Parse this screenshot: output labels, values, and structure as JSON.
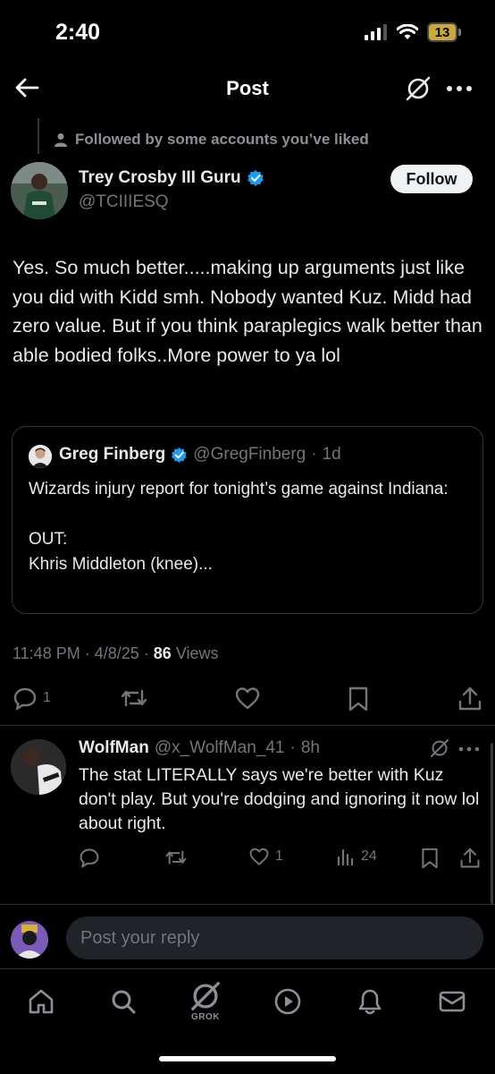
{
  "status_bar": {
    "time": "2:40",
    "battery": "13"
  },
  "header": {
    "title": "Post"
  },
  "social_context": "Followed by some accounts you’ve liked",
  "post": {
    "author_name": "Trey Crosby III Guru",
    "author_handle": "@TCIIIESQ",
    "follow_label": "Follow",
    "text": "Yes. So much better.....making up arguments just like you did with Kidd smh. Nobody wanted Kuz. Midd had zero value. But if you think paraplegics walk better than able bodied folks..More power to ya lol",
    "time": "11:48 PM",
    "date": "4/8/25",
    "views_count": "86",
    "views_label": "Views",
    "reply_count": "1"
  },
  "quote": {
    "author_name": "Greg Finberg",
    "author_handle": "@GregFinberg",
    "age": "1d",
    "text": "Wizards injury report for tonight’s game against Indiana:\n\nOUT:\nKhris Middleton (knee)..."
  },
  "reply": {
    "author_name": "WolfMan",
    "author_handle": "@x_WolfMan_41",
    "age": "8h",
    "text": "The stat LITERALLY says we're better with Kuz don't play. But you're dodging and ignoring it now lol about right.",
    "like_count": "1",
    "view_count": "24"
  },
  "composer": {
    "placeholder": "Post your reply"
  },
  "nav": {
    "grok_label": "GROK"
  },
  "colors": {
    "accent": "#1d9bf0",
    "muted": "#71767b",
    "text": "#e7e9ea",
    "background": "#000000"
  },
  "icons": [
    "back-arrow-icon",
    "grok-icon",
    "more-icon",
    "person-icon",
    "verified-badge-icon",
    "reply-icon",
    "retweet-icon",
    "like-icon",
    "bookmark-icon",
    "share-icon",
    "views-icon",
    "home-icon",
    "search-icon",
    "play-icon",
    "bell-icon",
    "mail-icon"
  ]
}
